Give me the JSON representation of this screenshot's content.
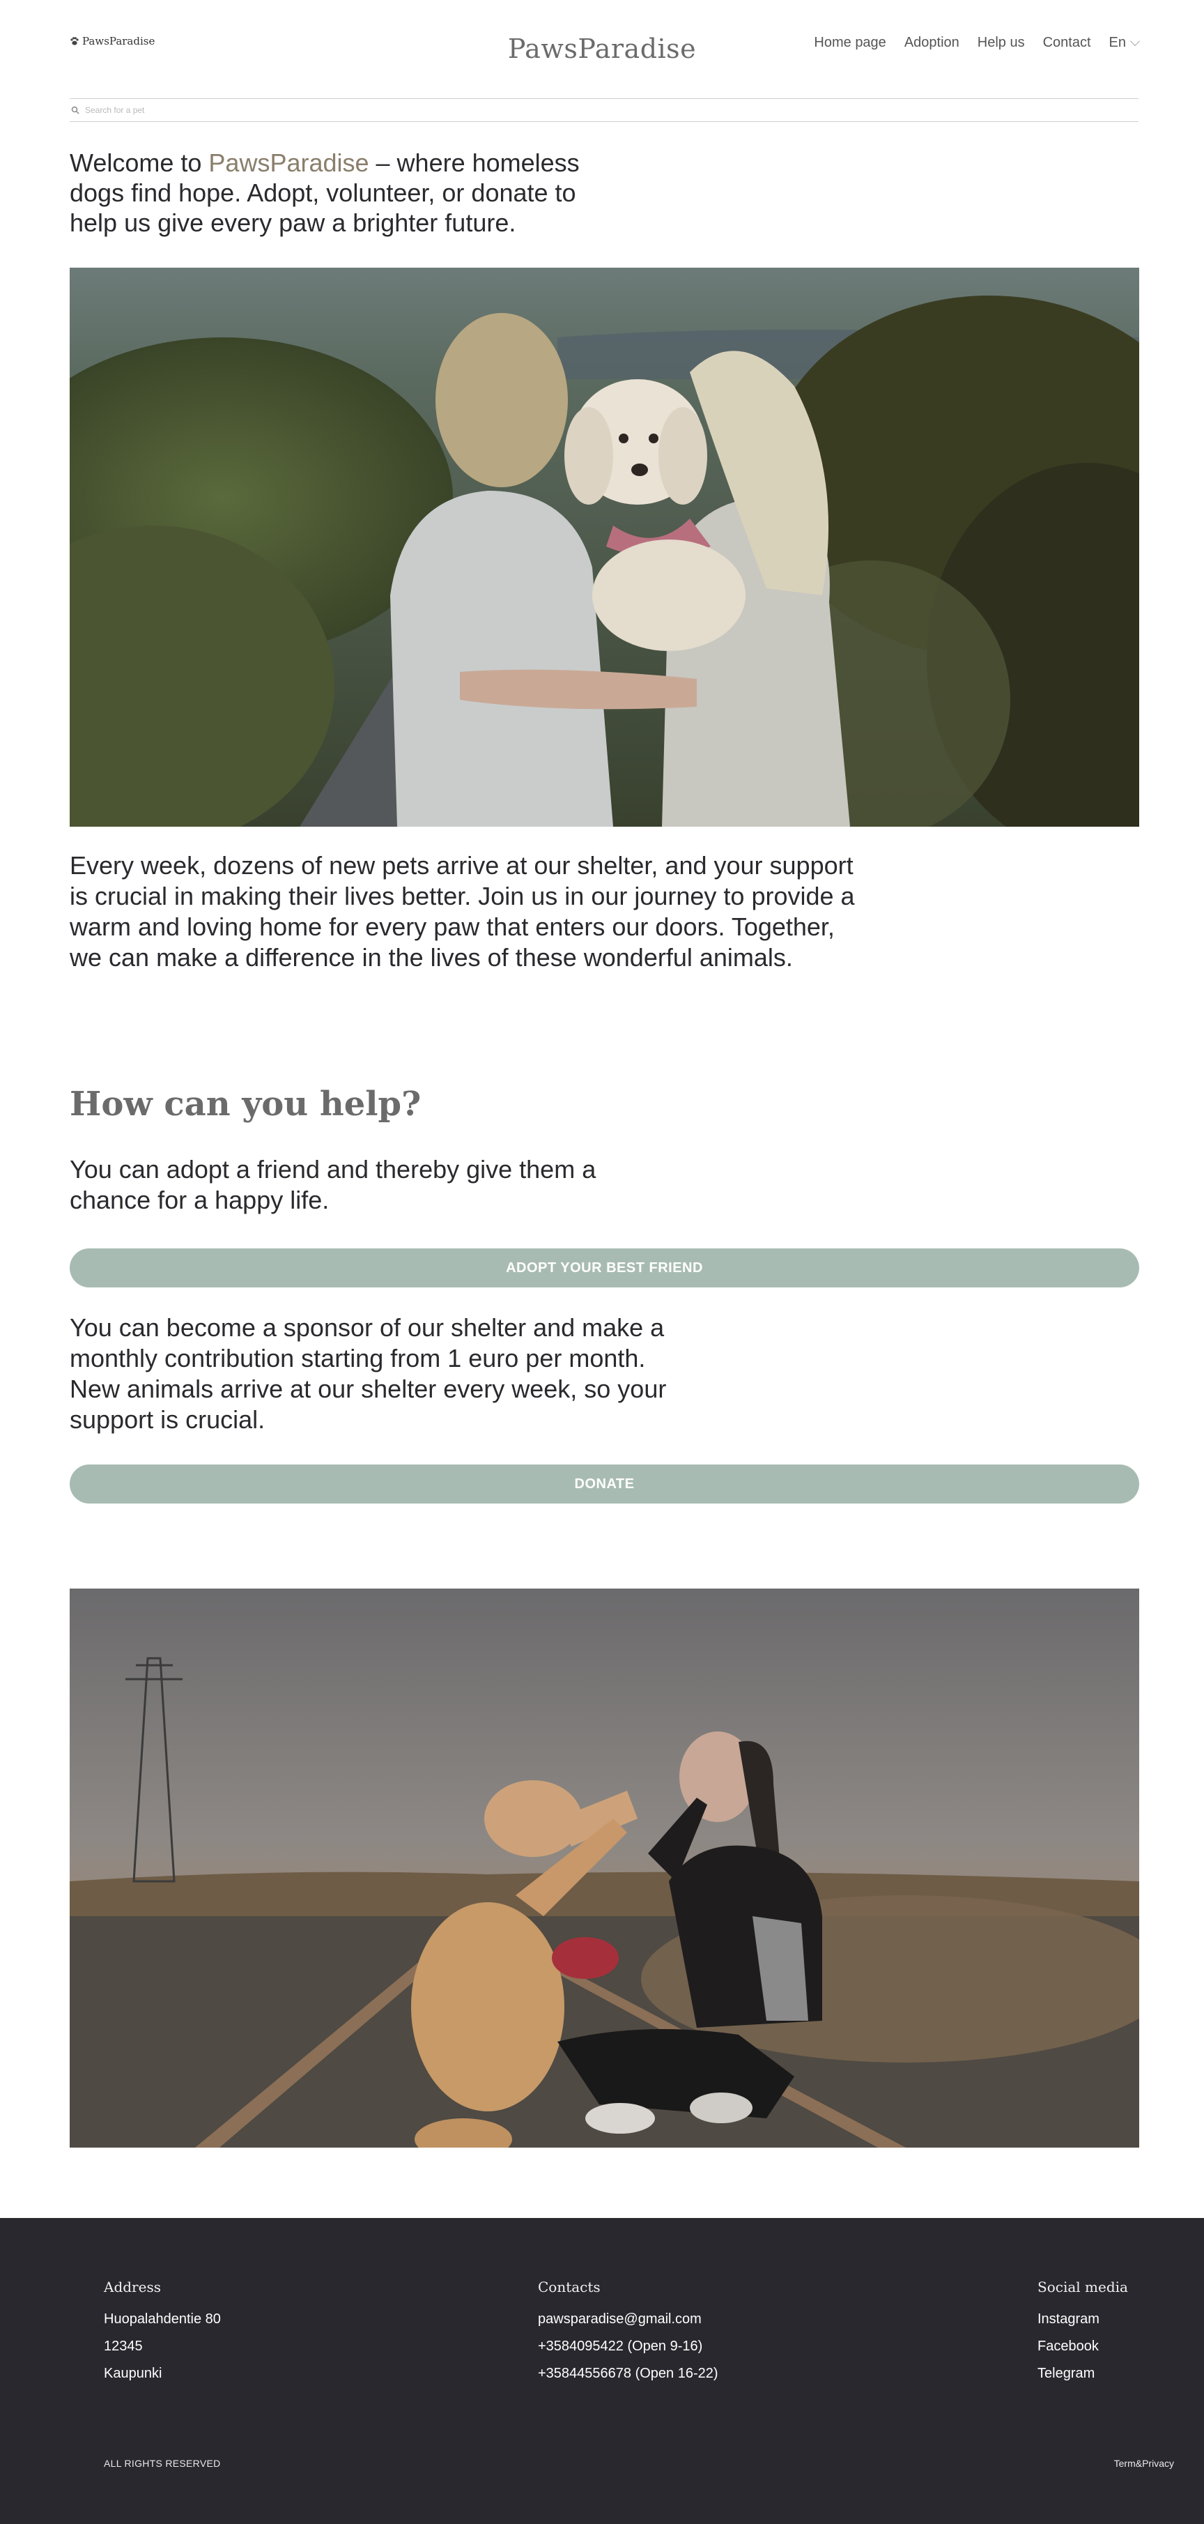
{
  "header": {
    "logo_small": "PawsParadise",
    "logo_center": "PawsParadise",
    "nav": [
      "Home page",
      "Adoption",
      "Help us",
      "Contact"
    ],
    "language": "En",
    "search_placeholder": "Search for a pet"
  },
  "welcome": {
    "prefix": "Welcome to ",
    "brand": "PawsParadise",
    "suffix": " – where homeless dogs find hope. Adopt, volunteer, or donate to help us give every paw a brighter future."
  },
  "intro": "Every week, dozens of new pets arrive at our shelter, and your support is crucial in making their lives better. Join us in our journey to provide a warm and loving home for every paw that enters our doors. Together, we can make a difference in the lives of these wonderful animals.",
  "help": {
    "title": "How can you help?",
    "adopt_text": "You can adopt a friend and thereby give them a chance for a happy life.",
    "adopt_button": "ADOPT YOUR BEST FRIEND",
    "sponsor_text": "You can become a sponsor of our shelter and make a monthly contribution starting from 1 euro per month. New animals arrive at our shelter every week, so your support is crucial.",
    "donate_button": "DONATE"
  },
  "footer": {
    "address_title": "Address",
    "address": [
      "Huopalahdentie 80",
      "12345",
      "Kaupunki"
    ],
    "contacts_title": "Contacts",
    "contacts": [
      "pawsparadise@gmail.com",
      "+3584095422 (Open 9-16)",
      "+35844556678 (Open 16-22)"
    ],
    "social_title": "Social media",
    "social": [
      "Instagram",
      "Facebook",
      "Telegram"
    ],
    "rights": "ALL RIGHTS RESERVED",
    "terms": "Term&Privacy"
  },
  "colors": {
    "brand": "#8a7e6c",
    "button": "#a8bbb3",
    "footer_bg": "#29282e"
  }
}
